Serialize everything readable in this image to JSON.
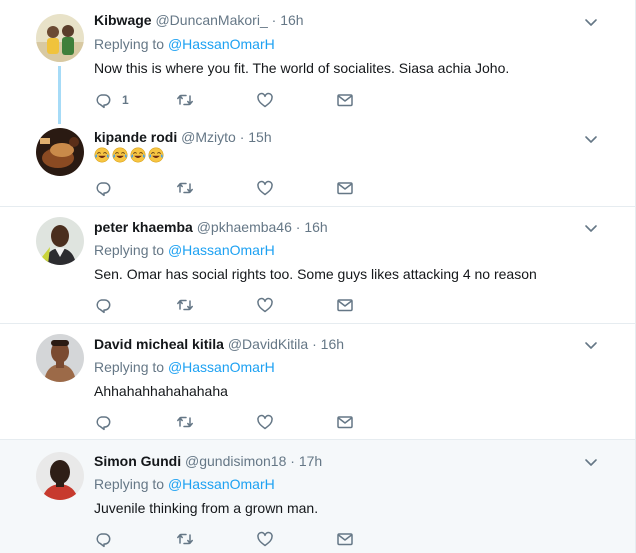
{
  "tweets": [
    {
      "name": "Kibwage",
      "handle": "@DuncanMakori_",
      "time": "16h",
      "replying_label": "Replying to",
      "replying_to": "@HassanOmarH",
      "text": "Now this is where you fit. The world of socialites. Siasa achia Joho.",
      "reply_count": "1"
    },
    {
      "name": "kipande rodi",
      "handle": "@Mziyto",
      "time": "15h",
      "text": "",
      "emoji": [
        "face-with-tears-of-joy",
        "face-with-tears-of-joy",
        "face-with-tears-of-joy",
        "face-with-tears-of-joy"
      ]
    },
    {
      "name": "peter khaemba",
      "handle": "@pkhaemba46",
      "time": "16h",
      "replying_label": "Replying to",
      "replying_to": "@HassanOmarH",
      "text": "Sen. Omar has social rights too. Some guys likes attacking 4 no reason"
    },
    {
      "name": "David micheal kitila",
      "handle": "@DavidKitila",
      "time": "16h",
      "replying_label": "Replying to",
      "replying_to": "@HassanOmarH",
      "text": "Ahhahahhahahahaha"
    },
    {
      "name": "Simon Gundi",
      "handle": "@gundisimon18",
      "time": "17h",
      "replying_label": "Replying to",
      "replying_to": "@HassanOmarH",
      "text": "Juvenile thinking from a grown man."
    }
  ],
  "separator": "·",
  "icons": {
    "reply": "reply-icon",
    "retweet": "retweet-icon",
    "like": "heart-icon",
    "message": "envelope-icon",
    "more": "chevron-down-icon"
  },
  "colors": {
    "link": "#1da1f2",
    "muted": "#657786",
    "thread_line": "#a6dbf7",
    "highlight_bg": "#f5f8fa"
  }
}
